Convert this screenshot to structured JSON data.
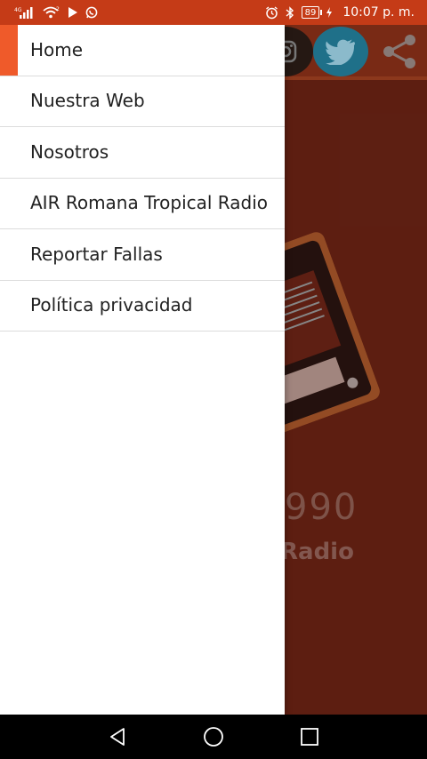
{
  "status_bar": {
    "signal_text": "4G",
    "wifi_text": "2",
    "battery_level": "89",
    "time": "10:07 p. m."
  },
  "colors": {
    "status_bar": "#c53b17",
    "accent": "#ef5a2a",
    "app_background": "#6a2314",
    "twitter": "#24809c"
  },
  "background_app": {
    "logo_number": "990",
    "logo_text": "Radio",
    "icons": [
      "instagram-icon",
      "twitter-icon",
      "share-icon"
    ]
  },
  "drawer": {
    "items": [
      {
        "label": "Home",
        "active": true
      },
      {
        "label": "Nuestra Web",
        "active": false
      },
      {
        "label": "Nosotros",
        "active": false
      },
      {
        "label": "AIR Romana Tropical Radio",
        "active": false
      },
      {
        "label": "Reportar Fallas",
        "active": false
      },
      {
        "label": "Política privacidad",
        "active": false
      }
    ]
  },
  "nav_bar": {
    "icons": [
      "back-icon",
      "home-icon",
      "recents-icon"
    ]
  }
}
